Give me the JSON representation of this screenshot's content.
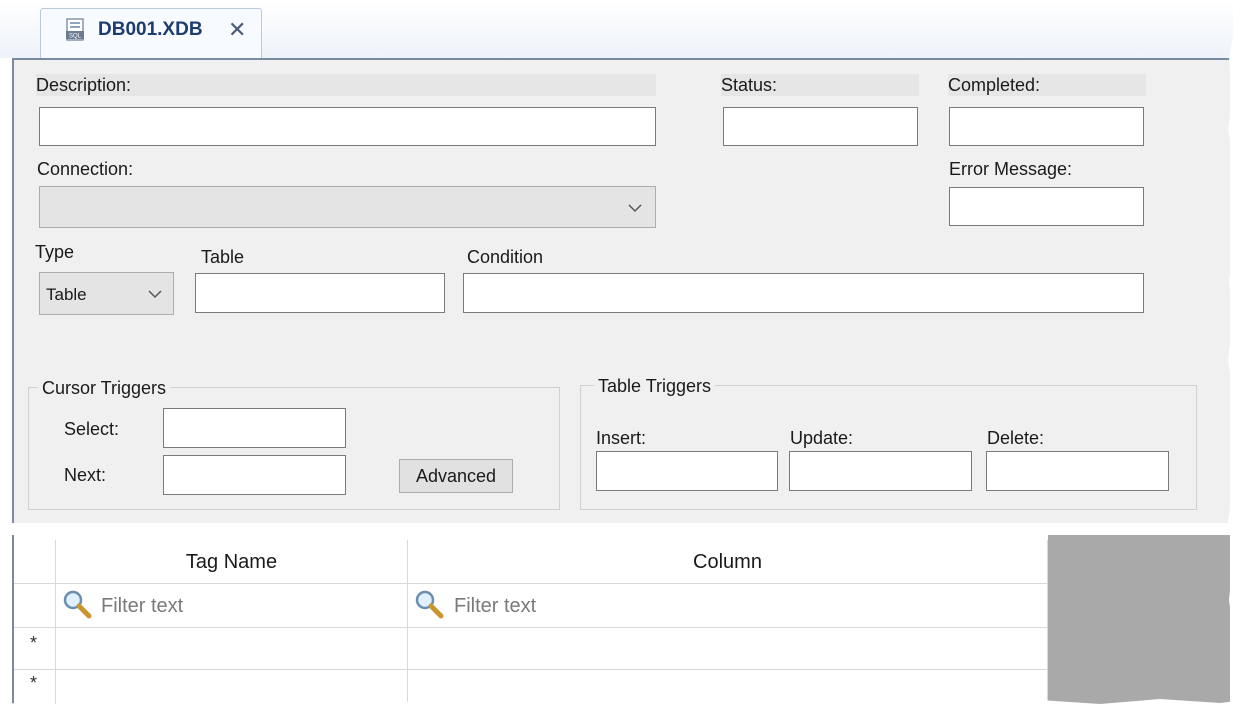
{
  "tab": {
    "title": "DB001.XDB",
    "close": "✕",
    "icon": "sql-file-icon"
  },
  "form": {
    "description_label": "Description:",
    "description_value": "",
    "status_label": "Status:",
    "status_value": "",
    "completed_label": "Completed:",
    "completed_value": "",
    "connection_label": "Connection:",
    "connection_value": "",
    "error_message_label": "Error Message:",
    "error_message_value": "",
    "type_label": "Type",
    "type_value": "Table",
    "table_label": "Table",
    "table_value": "",
    "condition_label": "Condition",
    "condition_value": ""
  },
  "cursor_triggers": {
    "title": "Cursor Triggers",
    "select_label": "Select:",
    "next_label": "Next:",
    "advanced_button": "Advanced"
  },
  "table_triggers": {
    "title": "Table Triggers",
    "insert_label": "Insert:",
    "update_label": "Update:",
    "delete_label": "Delete:"
  },
  "grid": {
    "columns": [
      "Tag Name",
      "Column"
    ],
    "filter_placeholder": "Filter text",
    "new_row_marker": "*"
  },
  "colors": {
    "tab_text": "#1e3c6e",
    "panel_bg": "#f0f0f0",
    "grid_empty": "#a9a9a9"
  }
}
